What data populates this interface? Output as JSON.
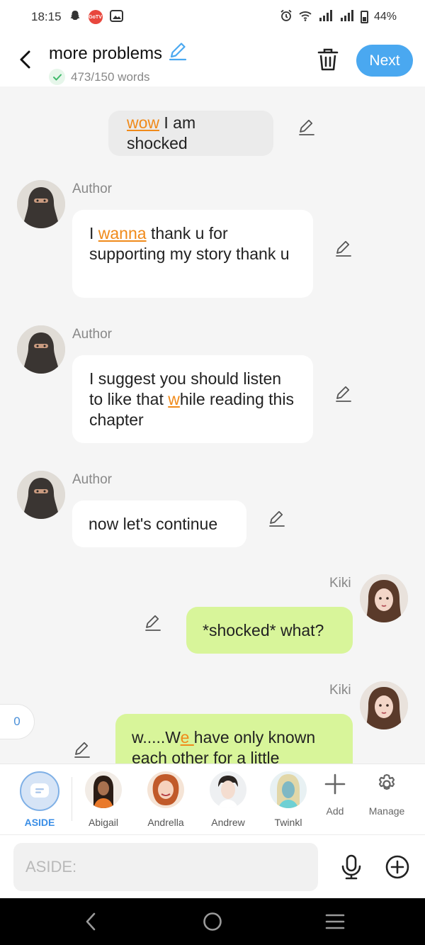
{
  "status_bar": {
    "time": "18:15",
    "gotv_badge": "GoTV",
    "battery": "44%",
    "icons": [
      "snapchat-icon",
      "gotv-icon",
      "gallery-icon",
      "alarm-icon",
      "wifi-icon",
      "signal-icon",
      "signal-icon",
      "battery-icon"
    ]
  },
  "header": {
    "title": "more problems",
    "word_count": "473/150 words",
    "next_label": "Next"
  },
  "messages": [
    {
      "type": "aside",
      "parts": [
        "wow",
        " I am shocked"
      ]
    },
    {
      "type": "author",
      "speaker": "Author",
      "parts": [
        "I ",
        "wanna",
        " thank u for supporting my story thank u"
      ]
    },
    {
      "type": "author",
      "speaker": "Author",
      "parts": [
        "I suggest you should listen to like that ",
        " w",
        "hile reading this chapter"
      ]
    },
    {
      "type": "author",
      "speaker": "Author",
      "text": "now let's continue"
    },
    {
      "type": "character",
      "speaker": "Kiki",
      "text": "*shocked* what?"
    },
    {
      "type": "character",
      "speaker": "Kiki",
      "parts": [
        "w.....W",
        "e ",
        "have only known each other for a little"
      ]
    }
  ],
  "comment_count": "0",
  "characters": [
    {
      "name": "ASIDE",
      "selected": true
    },
    {
      "name": "Abigail"
    },
    {
      "name": "Andrella"
    },
    {
      "name": "Andrew"
    },
    {
      "name": "Twinkl"
    }
  ],
  "tools": {
    "add_label": "Add",
    "manage_label": "Manage"
  },
  "input": {
    "placeholder": "ASIDE:"
  },
  "colors": {
    "accent_blue": "#4aa8f0",
    "character_bubble": "#d8f59a",
    "highlight_orange": "#f08a1a",
    "aside_bubble": "#ebebeb"
  }
}
